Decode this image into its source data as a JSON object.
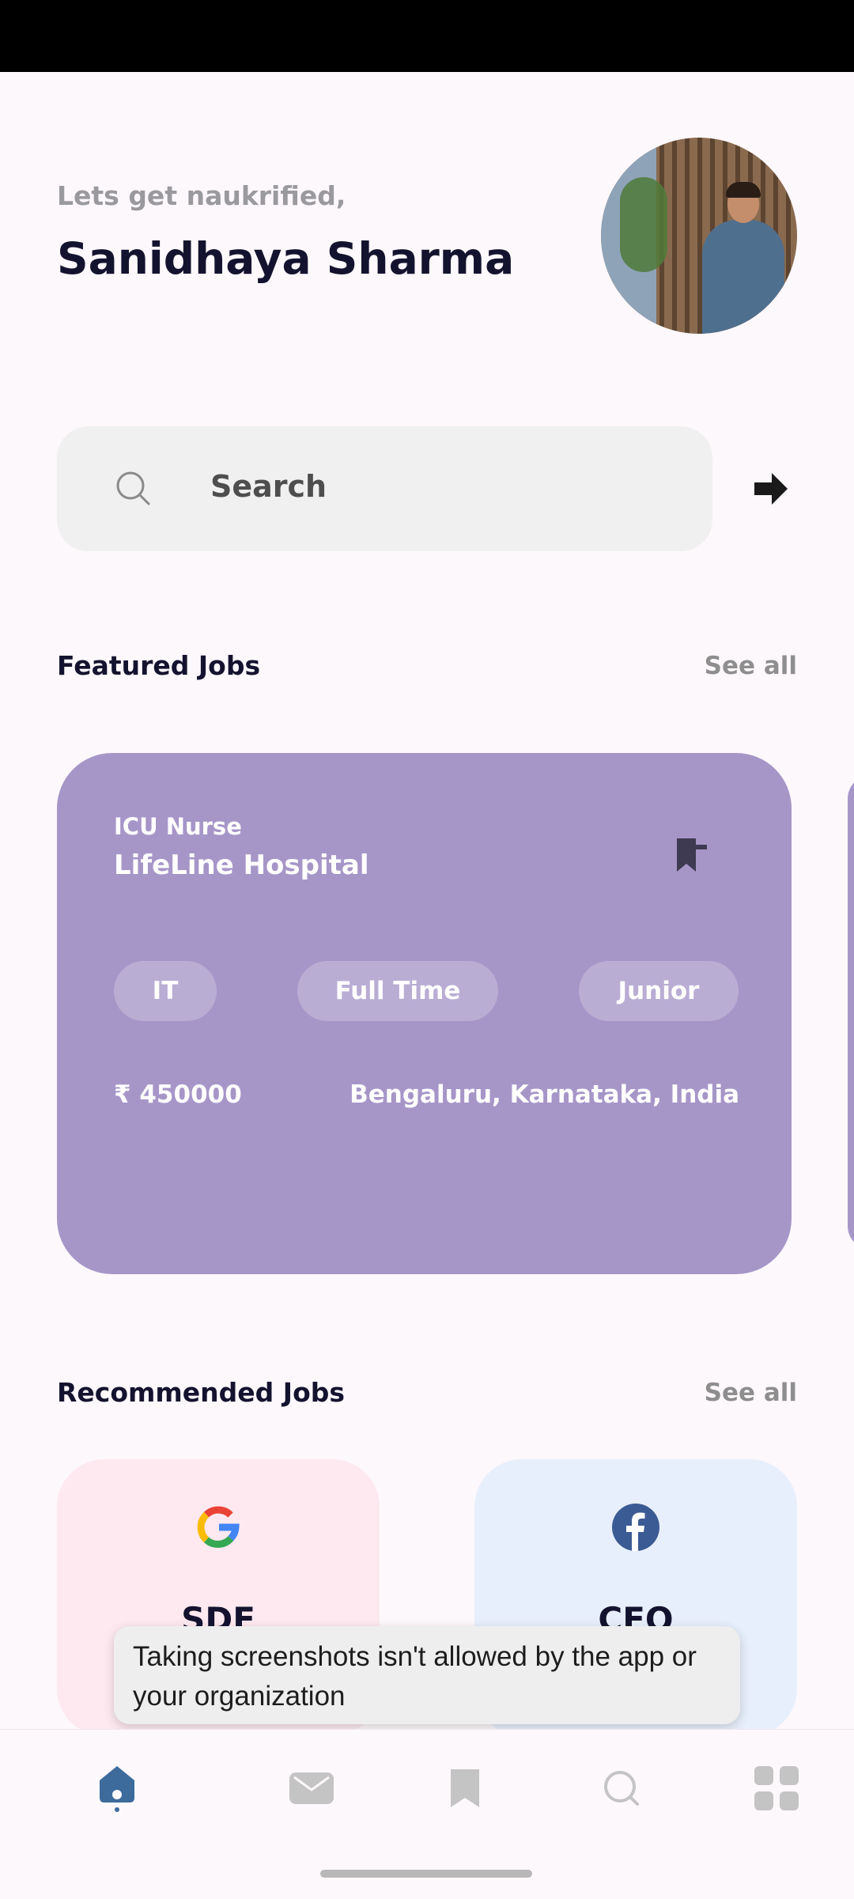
{
  "header": {
    "greeting": "Lets get naukrified,",
    "user_name": "Sanidhaya Sharma"
  },
  "search": {
    "placeholder": "Search"
  },
  "featured": {
    "title": "Featured Jobs",
    "see_all": "See all",
    "card": {
      "job_title": "ICU Nurse",
      "company": "LifeLine Hospital",
      "tags": [
        "IT",
        "Full Time",
        "Junior"
      ],
      "salary": "₹ 450000",
      "location": "Bengaluru, Karnataka, India"
    }
  },
  "recommended": {
    "title": "Recommended Jobs",
    "see_all": "See all",
    "cards": [
      {
        "company_icon": "google-icon",
        "title": "SDE"
      },
      {
        "company_icon": "facebook-icon",
        "title": "CEO"
      }
    ]
  },
  "toast": {
    "message": "Taking screenshots isn't allowed by the app or your organization"
  },
  "bottom_nav": [
    "home-icon",
    "mail-icon",
    "bookmark-icon",
    "search-icon",
    "grid-icon"
  ],
  "colors": {
    "accent": "#3d6b9c",
    "card": "#a696c8",
    "title": "#14132f"
  }
}
